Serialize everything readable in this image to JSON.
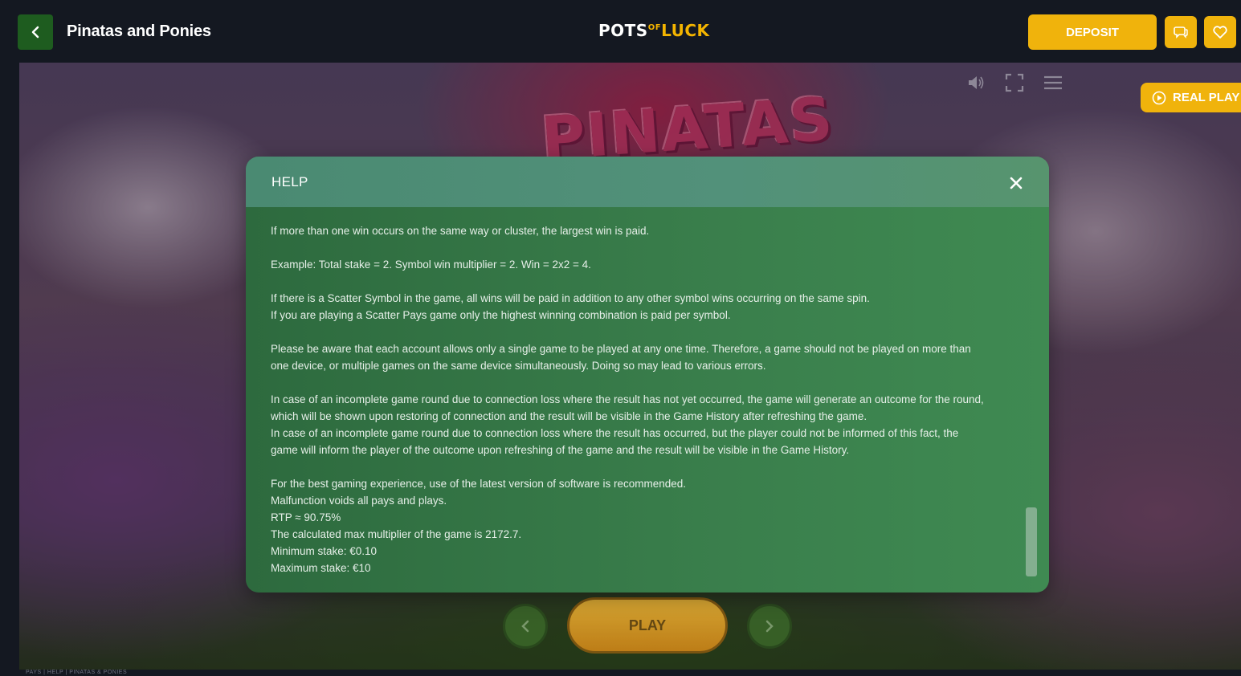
{
  "header": {
    "game_title": "Pinatas and Ponies",
    "logo": {
      "part1": "POTS",
      "part2": "OF",
      "part3": "LUCK"
    },
    "deposit_label": "DEPOSIT"
  },
  "game": {
    "banner_text": "PINATAS",
    "real_play_label": "REAL PLAY",
    "play_label": "PLAY"
  },
  "breadcrumb": "PAYS | HELP | PINATAS & PONIES",
  "help": {
    "title": "HELP",
    "paragraphs": [
      [
        "If more than one win occurs on the same way or cluster, the largest win is paid."
      ],
      [
        "Example: Total stake = 2. Symbol win multiplier = 2. Win = 2x2 = 4."
      ],
      [
        "If there is a Scatter Symbol in the game, all wins will be paid in addition to any other symbol wins occurring on the same spin.",
        "If you are playing a Scatter Pays game only the highest winning combination is paid per symbol."
      ],
      [
        "Please be aware that each account allows only a single game to be played at any one time. Therefore, a game should not be played on more than",
        "one device, or multiple games on the same device simultaneously. Doing so may lead to various errors."
      ],
      [
        "In case of an incomplete game round due to connection loss where the result has not yet occurred, the game will generate an outcome for the round,",
        "which will be shown upon restoring of connection and the result will be visible in the Game History after refreshing the game.",
        "In case of an incomplete game round due to connection loss where the result has occurred, but the player could not be informed of this fact, the",
        "game will inform the player of the outcome upon refreshing of the game and the result will be visible in the Game History."
      ],
      [
        "For the best gaming experience, use of the latest version of software is recommended.",
        "Malfunction voids all pays and plays.",
        "RTP ≈ 90.75%",
        "The calculated max multiplier of the game is 2172.7.",
        "Minimum stake: €0.10",
        "Maximum stake: €10"
      ]
    ]
  },
  "icons": {
    "back": "chevron-left-icon",
    "chat": "chat-icon",
    "favorite": "heart-icon",
    "sound": "speaker-icon",
    "fullscreen": "fullscreen-icon",
    "menu": "menu-icon",
    "play_circle": "play-circle-icon",
    "close": "close-icon"
  },
  "colors": {
    "accent": "#f0b30c",
    "back_button": "#1e5c1f",
    "modal_bg": "#3a7f4c",
    "modal_header": "#52917a"
  }
}
